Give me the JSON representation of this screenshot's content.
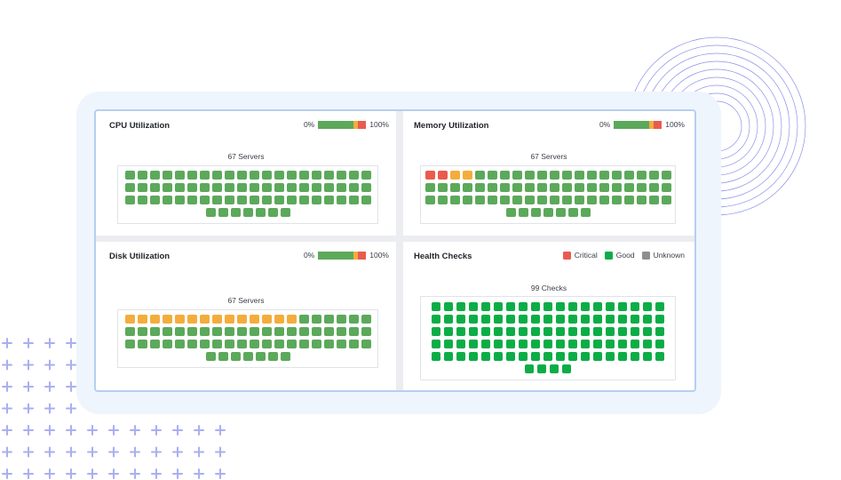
{
  "colors": {
    "good": "#5ca95b",
    "warning": "#f4ad3c",
    "critical": "#ea5b4f",
    "health_good": "#0cad46",
    "unknown": "#8f8f8f",
    "circle_stroke": "#8e92e8",
    "plus": "#a9aff2"
  },
  "scale": {
    "min_label": "0%",
    "max_label": "100%",
    "segments": [
      {
        "status": "good",
        "fraction": 0.74
      },
      {
        "status": "warning",
        "fraction": 0.08
      },
      {
        "status": "critical",
        "fraction": 0.18
      }
    ]
  },
  "cpu": {
    "title": "CPU Utilization",
    "count_label": "67 Servers",
    "cells": [
      {
        "status": "good",
        "count": 67
      }
    ]
  },
  "memory": {
    "title": "Memory Utilization",
    "count_label": "67 Servers",
    "cells": [
      {
        "status": "critical",
        "count": 2
      },
      {
        "status": "warning",
        "count": 2
      },
      {
        "status": "good",
        "count": 63
      }
    ]
  },
  "disk": {
    "title": "Disk Utilization",
    "count_label": "67 Servers",
    "cells": [
      {
        "status": "warning",
        "count": 14
      },
      {
        "status": "good",
        "count": 53
      }
    ]
  },
  "health": {
    "title": "Health Checks",
    "count_label": "99 Checks",
    "legend": [
      {
        "label": "Critical",
        "status": "critical"
      },
      {
        "label": "Good",
        "status": "health_good"
      },
      {
        "label": "Unknown",
        "status": "unknown"
      }
    ],
    "cells": [
      {
        "status": "health_good",
        "count": 99
      }
    ]
  }
}
